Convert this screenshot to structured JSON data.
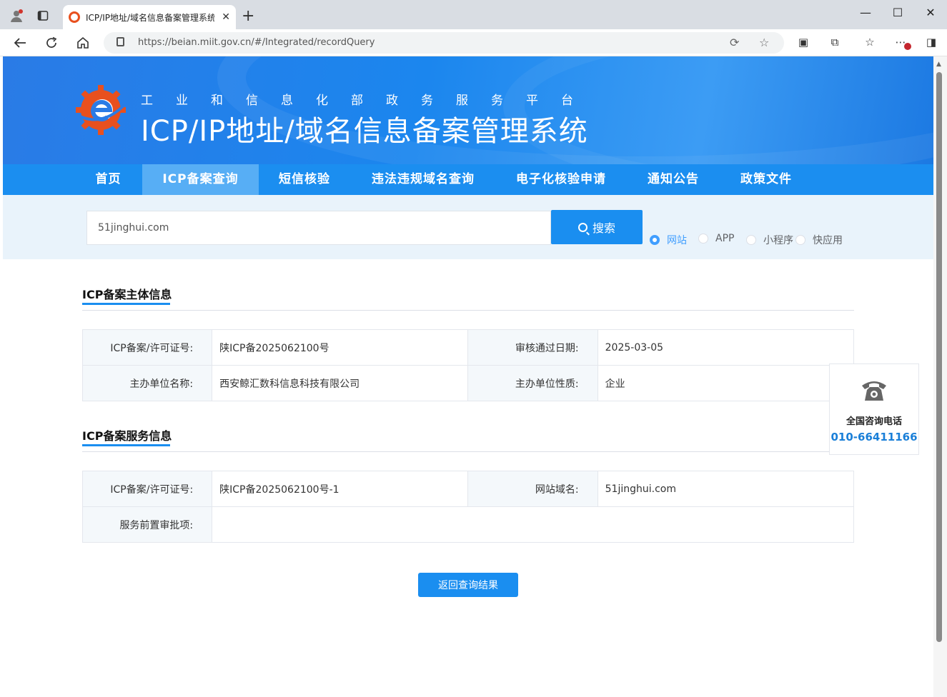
{
  "browser": {
    "tab_title": "ICP/IP地址/域名信息备案管理系统",
    "url": "https://beian.miit.gov.cn/#/Integrated/recordQuery"
  },
  "header": {
    "subtitle": "工业和信息化部政务服务平台",
    "title": "ICP/IP地址/域名信息备案管理系统"
  },
  "nav": {
    "items": [
      "首页",
      "ICP备案查询",
      "短信核验",
      "违法违规域名查询",
      "电子化核验申请",
      "通知公告",
      "政策文件"
    ],
    "active": "ICP备案查询"
  },
  "search": {
    "value": "51jinghui.com",
    "button_label": "搜索",
    "options": [
      "网站",
      "APP",
      "小程序",
      "快应用"
    ],
    "selected": "网站"
  },
  "subject_section": {
    "title": "ICP备案主体信息",
    "license_label": "ICP备案/许可证号:",
    "license_value": "陕ICP备2025062100号",
    "date_label": "审核通过日期:",
    "date_value": "2025-03-05",
    "org_label": "主办单位名称:",
    "org_value": "西安鲸汇数科信息科技有限公司",
    "type_label": "主办单位性质:",
    "type_value": "企业"
  },
  "service_section": {
    "title": "ICP备案服务信息",
    "license_label": "ICP备案/许可证号:",
    "license_value": "陕ICP备2025062100号-1",
    "domain_label": "网站域名:",
    "domain_value": "51jinghui.com",
    "approval_label": "服务前置审批项:",
    "approval_value": ""
  },
  "back_button_label": "返回查询结果",
  "hotline": {
    "label": "全国咨询电话",
    "number": "010-66411166"
  },
  "colors": {
    "primary": "#1a8ef0",
    "nav_active": "#57aef5",
    "hotline_number": "#1a7fd8",
    "logo_orange": "#e8501e"
  }
}
